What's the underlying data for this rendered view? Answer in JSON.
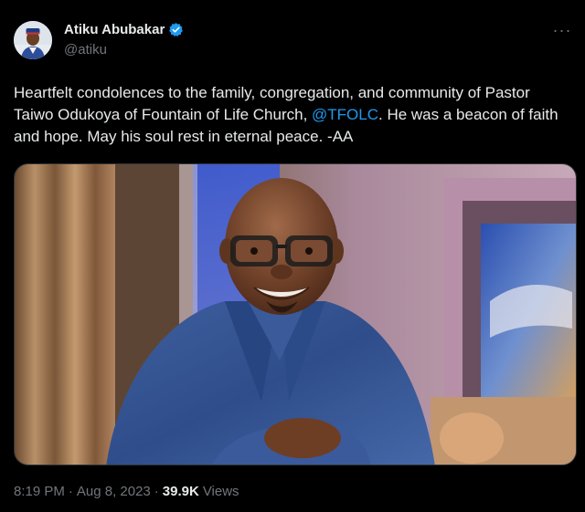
{
  "author": {
    "display_name": "Atiku Abubakar",
    "handle": "@atiku",
    "verified": true,
    "avatar_icon": "profile-photo",
    "verified_icon": "verified-badge-icon",
    "verified_color": "#1d9bf0"
  },
  "more_icon": "more-options-icon",
  "more_glyph": "···",
  "tweet": {
    "text_before": "Heartfelt condolences to the family, congregation, and community of Pastor Taiwo Odukoya of Fountain of Life Church, ",
    "mention": "@TFOLC",
    "text_after": ". He was a beacon of faith and hope. May his soul rest in eternal peace. -AA"
  },
  "media": {
    "type": "photo"
  },
  "meta": {
    "time": "8:19 PM",
    "separator1": "·",
    "date": "Aug 8, 2023",
    "separator2": "·",
    "views_count": "39.9K",
    "views_label": "Views"
  },
  "colors": {
    "background": "#000000",
    "text_primary": "#e7e9ea",
    "text_secondary": "#71767b",
    "link": "#1d9bf0"
  }
}
